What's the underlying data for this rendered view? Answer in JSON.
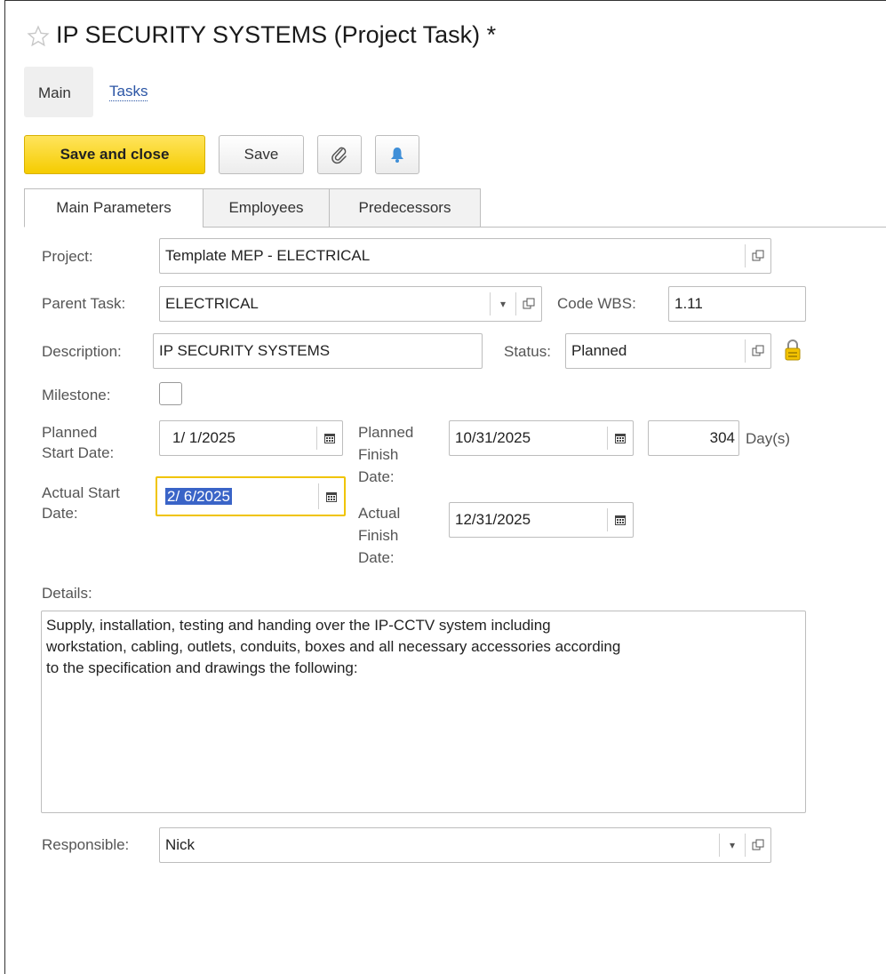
{
  "window": {
    "title": "IP SECURITY SYSTEMS (Project Task) *"
  },
  "nav": {
    "main": "Main",
    "tasks": "Tasks"
  },
  "toolbar": {
    "save_close": "Save and close",
    "save": "Save"
  },
  "form_tabs": [
    "Main Parameters",
    "Employees",
    "Predecessors"
  ],
  "form": {
    "project_label": "Project:",
    "project_value": "Template MEP - ELECTRICAL",
    "parent_label": "Parent Task:",
    "parent_value": "ELECTRICAL",
    "code_label": "Code WBS:",
    "code_value": "1.11",
    "desc_label": "Description:",
    "desc_value": "IP SECURITY SYSTEMS",
    "status_label": "Status:",
    "status_value": "Planned",
    "milestone_label": "Milestone:",
    "pstart_label_1": "Planned",
    "pstart_label_2": "Start Date:",
    "pstart_value": "1/ 1/2025",
    "pfinish_label_1": "Planned",
    "pfinish_label_2": "Finish",
    "pfinish_label_3": "Date:",
    "pfinish_value": "10/31/2025",
    "duration_value": "304",
    "duration_unit": "Day(s)",
    "astart_label_1": "Actual Start",
    "astart_label_2": "Date:",
    "astart_value": "2/ 6/2025",
    "afinish_label_1": "Actual",
    "afinish_label_2": "Finish",
    "afinish_label_3": "Date:",
    "afinish_value": "12/31/2025",
    "details_label": "Details:",
    "details_lines": [
      "Supply, installation, testing and handing over the IP-CCTV system including",
      "workstation, cabling, outlets, conduits, boxes and all necessary accessories according",
      "to the specification and drawings the following:"
    ],
    "responsible_label": "Responsible:",
    "responsible_value": "Nick"
  },
  "colors": {
    "accent": "#f5cc00",
    "link": "#2b55a5",
    "selection": "#3a64c7"
  },
  "icons": [
    "star-icon",
    "paperclip-icon",
    "bell-icon",
    "open-icon",
    "dropdown-icon",
    "calendar-icon",
    "lock-icon"
  ]
}
